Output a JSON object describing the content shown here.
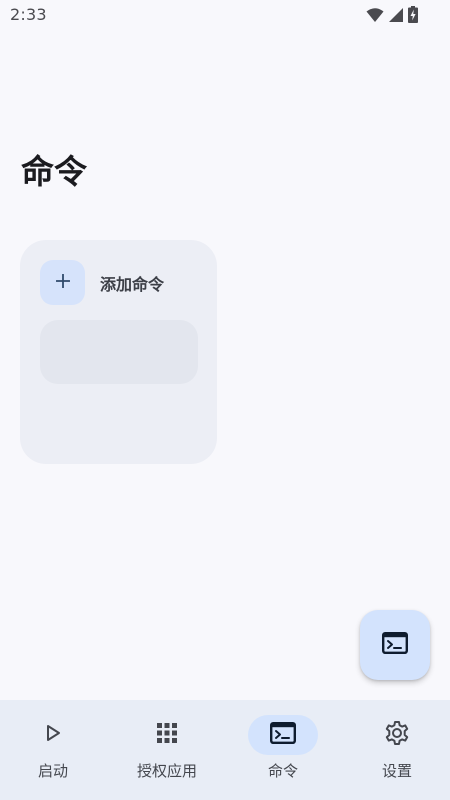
{
  "status_bar": {
    "time": "2:33",
    "icons": [
      "wifi-icon",
      "cell-signal-icon",
      "battery-charging-icon"
    ]
  },
  "page": {
    "title": "命令"
  },
  "command_card": {
    "add_label": "添加命令",
    "add_icon": "plus-icon"
  },
  "fab": {
    "icon": "terminal-icon"
  },
  "bottom_nav": {
    "items": [
      {
        "label": "启动",
        "icon": "play-icon",
        "active": false
      },
      {
        "label": "授权应用",
        "icon": "apps-grid-icon",
        "active": false
      },
      {
        "label": "命令",
        "icon": "terminal-icon",
        "active": true
      },
      {
        "label": "设置",
        "icon": "gear-icon",
        "active": false
      }
    ]
  },
  "colors": {
    "background": "#f8f8fc",
    "card": "#eceef5",
    "accent_container": "#d3e3fd",
    "nav_background": "#e8edf6",
    "icon_dark": "#1b1b1f"
  }
}
